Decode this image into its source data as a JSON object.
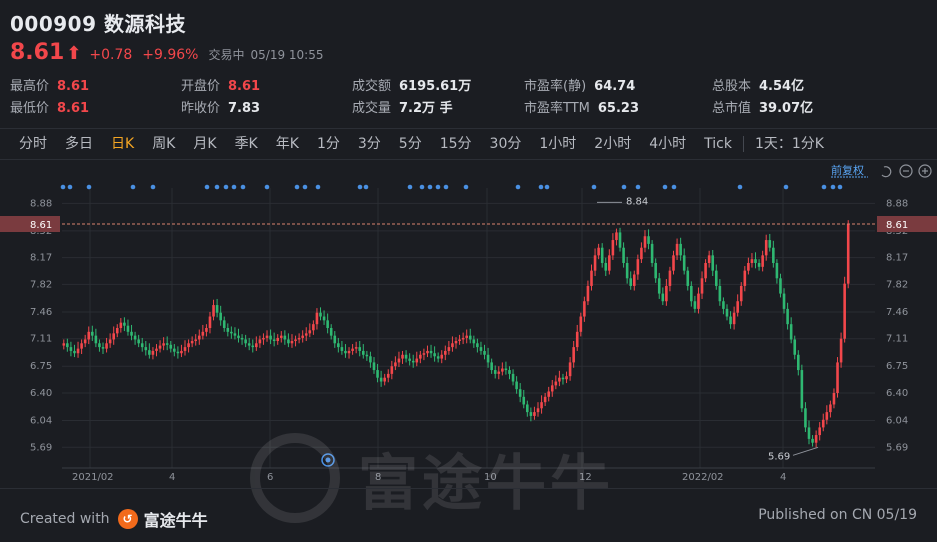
{
  "stock": {
    "title": "000909 数源科技",
    "price": "8.61",
    "arrow": "⬆",
    "change": "+0.78",
    "change_pct": "+9.96%",
    "status": "交易中",
    "time": "05/19 10:55"
  },
  "stats": [
    {
      "k": "最高价",
      "v": "8.61",
      "red": true
    },
    {
      "k": "最低价",
      "v": "8.61",
      "red": true
    },
    {
      "k": "开盘价",
      "v": "8.61",
      "red": true
    },
    {
      "k": "昨收价",
      "v": "7.83",
      "red": false
    },
    {
      "k": "成交额",
      "v": "6195.61万",
      "red": false
    },
    {
      "k": "成交量",
      "v": "7.2万 手",
      "red": false
    },
    {
      "k": "市盈率(静)",
      "v": "64.74",
      "red": false
    },
    {
      "k": "市盈率TTM",
      "v": "65.23",
      "red": false
    },
    {
      "k": "总股本",
      "v": "4.54亿",
      "red": false
    },
    {
      "k": "总市值",
      "v": "39.07亿",
      "red": false
    }
  ],
  "tabs": [
    "分时",
    "多日",
    "日K",
    "周K",
    "月K",
    "季K",
    "年K",
    "1分",
    "3分",
    "5分",
    "15分",
    "30分",
    "1小时",
    "2小时",
    "4小时",
    "Tick",
    "1天：1分K"
  ],
  "active_tab": "日K",
  "chart_controls": {
    "adjust_label": "前复权"
  },
  "chart_data": {
    "type": "candlestick",
    "y_ticks": [
      "8.88",
      "8.52",
      "8.17",
      "7.82",
      "7.46",
      "7.11",
      "6.75",
      "6.40",
      "6.04",
      "5.69"
    ],
    "x_ticks": [
      "2021/02",
      "4",
      "6",
      "8",
      "10",
      "12",
      "2022/02",
      "4"
    ],
    "current_price_label": "8.61",
    "high_label": "8.84",
    "low_label": "5.69",
    "colors": {
      "up": "#f2474b",
      "down": "#2fb872",
      "marker": "#4a90e2",
      "grid": "#2a2d33"
    },
    "series": [
      7.05,
      7.0,
      6.95,
      6.92,
      6.98,
      7.05,
      7.1,
      7.2,
      7.15,
      7.05,
      7.0,
      6.98,
      7.05,
      7.1,
      7.18,
      7.25,
      7.32,
      7.28,
      7.2,
      7.15,
      7.1,
      7.05,
      7.0,
      6.96,
      6.9,
      6.95,
      6.98,
      7.02,
      7.05,
      7.03,
      6.98,
      6.94,
      6.92,
      6.95,
      7.0,
      7.05,
      7.08,
      7.1,
      7.15,
      7.2,
      7.25,
      7.4,
      7.55,
      7.45,
      7.35,
      7.25,
      7.2,
      7.18,
      7.15,
      7.12,
      7.1,
      7.05,
      7.02,
      7.0,
      7.05,
      7.1,
      7.12,
      7.15,
      7.1,
      7.08,
      7.12,
      7.15,
      7.1,
      7.05,
      7.08,
      7.1,
      7.12,
      7.15,
      7.18,
      7.22,
      7.3,
      7.45,
      7.4,
      7.35,
      7.25,
      7.15,
      7.05,
      7.0,
      6.95,
      6.92,
      6.95,
      6.98,
      7.0,
      6.95,
      6.9,
      6.88,
      6.8,
      6.7,
      6.6,
      6.55,
      6.6,
      6.65,
      6.75,
      6.8,
      6.85,
      6.9,
      6.85,
      6.82,
      6.8,
      6.85,
      6.9,
      6.92,
      6.95,
      6.92,
      6.88,
      6.85,
      6.9,
      6.95,
      7.0,
      7.05,
      7.08,
      7.1,
      7.12,
      7.15,
      7.1,
      7.05,
      7.0,
      6.95,
      6.9,
      6.8,
      6.7,
      6.65,
      6.68,
      6.72,
      6.7,
      6.65,
      6.55,
      6.45,
      6.35,
      6.25,
      6.15,
      6.1,
      6.15,
      6.2,
      6.28,
      6.35,
      6.42,
      6.5,
      6.55,
      6.6,
      6.58,
      6.62,
      6.8,
      7.0,
      7.2,
      7.4,
      7.6,
      7.8,
      8.0,
      8.2,
      8.3,
      8.1,
      8.0,
      8.2,
      8.4,
      8.5,
      8.3,
      8.1,
      7.9,
      7.8,
      7.95,
      8.15,
      8.3,
      8.45,
      8.35,
      8.1,
      7.9,
      7.7,
      7.6,
      7.8,
      8.0,
      8.2,
      8.35,
      8.2,
      8.0,
      7.8,
      7.6,
      7.5,
      7.7,
      7.9,
      8.1,
      8.2,
      8.0,
      7.8,
      7.6,
      7.5,
      7.4,
      7.3,
      7.45,
      7.6,
      7.8,
      8.0,
      8.1,
      8.15,
      8.1,
      8.05,
      8.2,
      8.4,
      8.3,
      8.1,
      7.9,
      7.7,
      7.5,
      7.3,
      7.1,
      6.9,
      6.7,
      6.2,
      5.95,
      5.8,
      5.75,
      5.85,
      5.95,
      6.05,
      6.15,
      6.25,
      6.4,
      6.8,
      7.11,
      7.83,
      8.61
    ]
  },
  "watermark": {
    "text": "富途牛牛"
  },
  "footer": {
    "created_prefix": "Created with",
    "brand": "富途牛牛",
    "published": "Published on CN 05/19"
  }
}
